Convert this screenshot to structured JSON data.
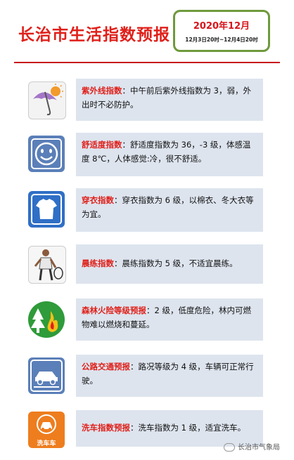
{
  "header": {
    "title": "长治市生活指数预报",
    "date_main": "2020年12月",
    "date_range": "12月3日20时~12月4日20时"
  },
  "items": [
    {
      "icon": "umbrella-sun-icon",
      "label": "紫外线指数",
      "text": "中午前后紫外线指数为 3，弱，外出时不必防护。"
    },
    {
      "icon": "smiley-face-icon",
      "label": "舒适度指数",
      "text": "舒适度指数为 36，-3 级，体感温度 8℃，人体感觉:冷，很不舒适。"
    },
    {
      "icon": "tshirt-icon",
      "label": "穿衣指数",
      "text": "穿衣指数为 6 级，以棉衣、冬大衣等为宜。"
    },
    {
      "icon": "tennis-player-icon",
      "label": "晨练指数",
      "text": "晨练指数为 5 级，不适宜晨练。"
    },
    {
      "icon": "forest-fire-icon",
      "label": "森林火险等级预报",
      "text": "2 级，低度危险，林内可燃物难以燃烧和蔓延。"
    },
    {
      "icon": "car-road-icon",
      "label": "公路交通预报",
      "text": "路况等级为 4 级，车辆可正常行驶。"
    },
    {
      "icon": "car-wash-icon",
      "label": "洗车指数预报",
      "text": "洗车指数为 1 级，适宜洗车。",
      "icon_caption": "洗车车"
    }
  ],
  "watermark": "长治市气象局"
}
